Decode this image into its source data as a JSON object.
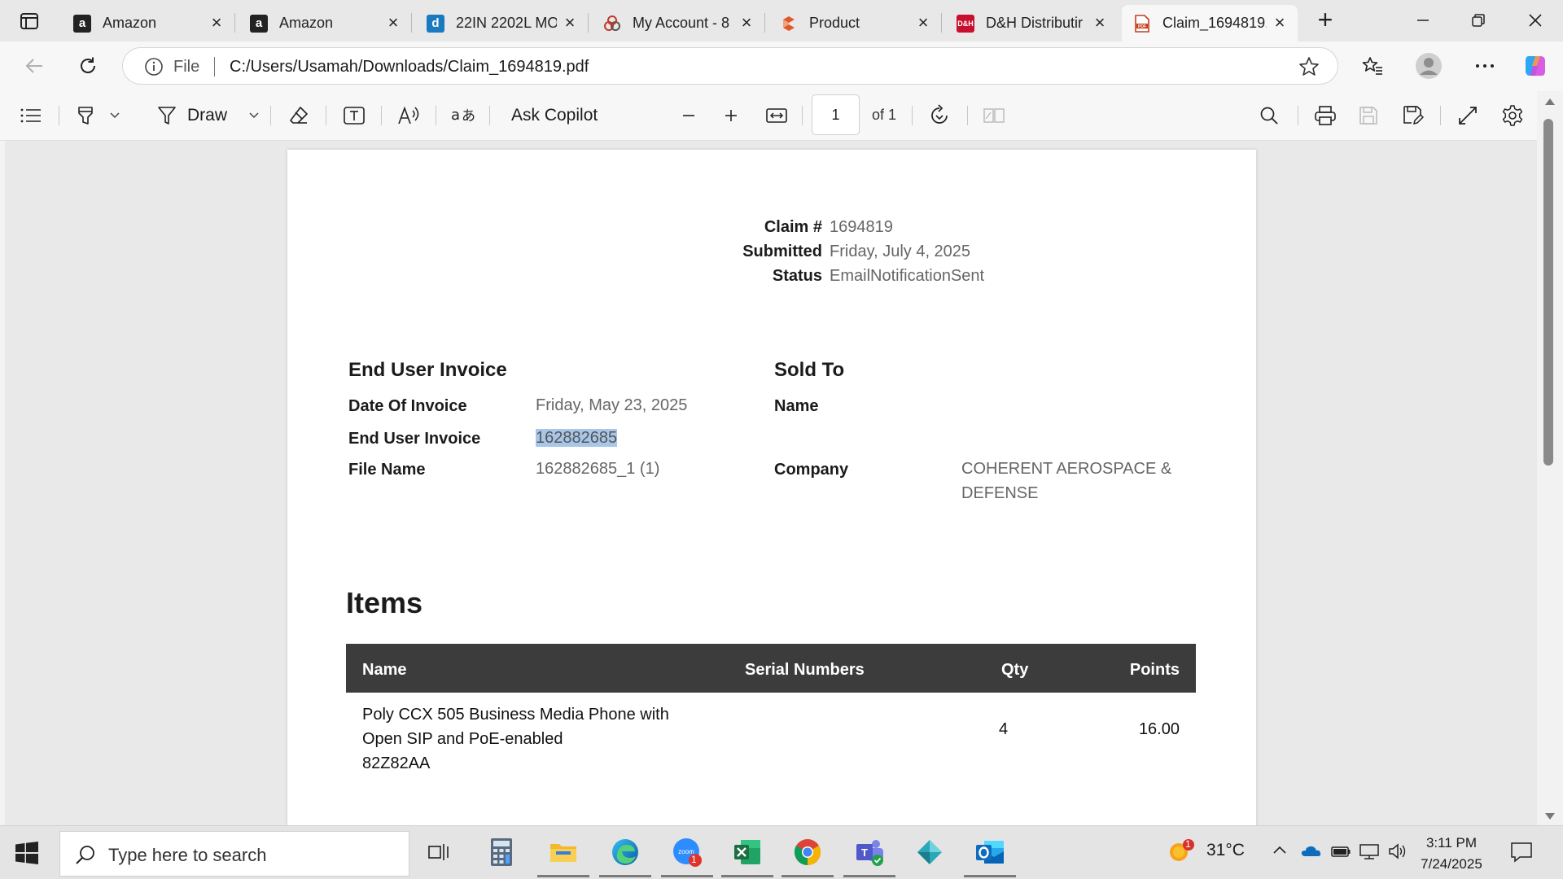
{
  "browser": {
    "tabs": [
      {
        "label": "Amazon",
        "icon": "amazon-icon"
      },
      {
        "label": "Amazon",
        "icon": "amazon-icon"
      },
      {
        "label": "22IN 2202L MO",
        "icon": "dell-icon"
      },
      {
        "label": "My Account - 8",
        "icon": "account-icon"
      },
      {
        "label": "Product",
        "icon": "product-icon"
      },
      {
        "label": "D&H Distributir",
        "icon": "dh-icon"
      },
      {
        "label": "Claim_1694819.",
        "icon": "pdf-icon",
        "active": true
      }
    ],
    "address": {
      "scheme": "File",
      "url": "C:/Users/Usamah/Downloads/Claim_1694819.pdf"
    }
  },
  "pdf_toolbar": {
    "draw_label": "Draw",
    "copilot_label": "Ask Copilot",
    "page_number": "1",
    "page_total": "of 1"
  },
  "document": {
    "claim": {
      "claim_label": "Claim #",
      "claim_value": "1694819",
      "submitted_label": "Submitted",
      "submitted_value": "Friday, July 4, 2025",
      "status_label": "Status",
      "status_value": "EmailNotificationSent"
    },
    "end_user_invoice": {
      "heading": "End User Invoice",
      "date_label": "Date Of Invoice",
      "date_value": "Friday, May 23, 2025",
      "invoice_label": "End User Invoice",
      "invoice_value": "162882685",
      "file_label": "File Name",
      "file_value": "162882685_1 (1)"
    },
    "sold_to": {
      "heading": "Sold To",
      "name_label": "Name",
      "name_value": "",
      "company_label": "Company",
      "company_line1": "COHERENT AEROSPACE &",
      "company_line2": "DEFENSE"
    },
    "items": {
      "title": "Items",
      "columns": [
        "Name",
        "Serial Numbers",
        "Qty",
        "Points"
      ],
      "rows": [
        {
          "name_line1": "Poly CCX 505 Business Media Phone with",
          "name_line2": "Open SIP and PoE-enabled",
          "name_line3": "82Z82AA",
          "serial": "",
          "qty": "4",
          "points": "16.00"
        }
      ]
    }
  },
  "taskbar": {
    "search_placeholder": "Type here to search",
    "weather_temp": "31°C",
    "weather_badge": "1",
    "zoom_badge": "1",
    "time": "3:11 PM",
    "date": "7/24/2025"
  },
  "colors": {
    "table_header": "#3c3c3c",
    "highlight": "#a8c7e8",
    "excel": "#1d6f42",
    "outlook": "#0f6cbd",
    "teams": "#5059c9"
  }
}
